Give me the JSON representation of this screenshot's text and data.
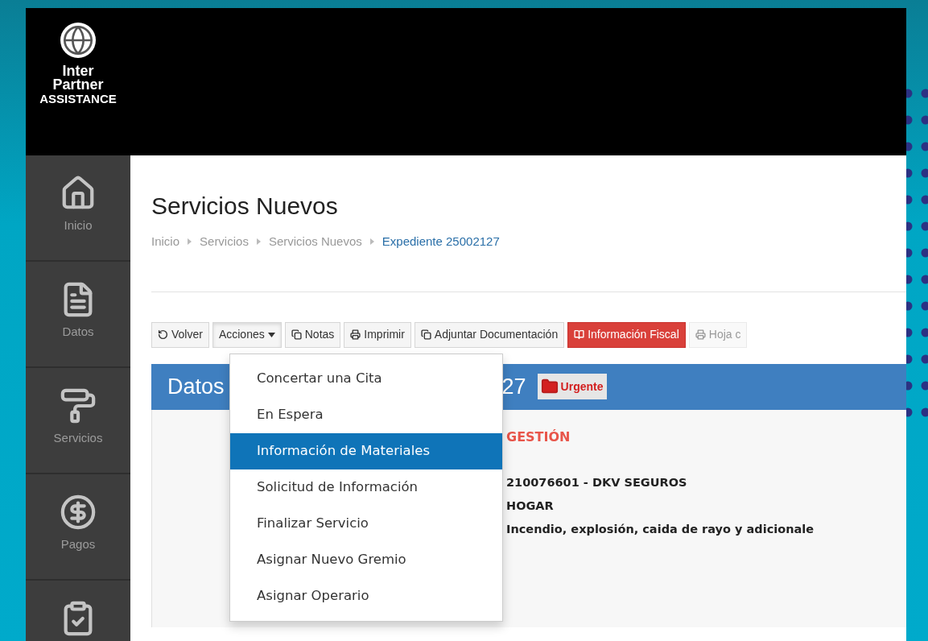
{
  "logo": {
    "lines": [
      "Inter",
      "Partner",
      "ASSISTANCE"
    ]
  },
  "sidebar": {
    "items": [
      {
        "kind": "home",
        "label": "Inicio"
      },
      {
        "kind": "document",
        "label": "Datos"
      },
      {
        "kind": "roller",
        "label": "Servicios"
      },
      {
        "kind": "dollar",
        "label": "Pagos"
      },
      {
        "kind": "clipboard"
      }
    ]
  },
  "page": {
    "title": "Servicios Nuevos"
  },
  "breadcrumb": [
    {
      "label": "Inicio",
      "current": false
    },
    {
      "label": "Servicios",
      "current": false
    },
    {
      "label": "Servicios Nuevos",
      "current": false
    },
    {
      "label": "Expediente 25002127",
      "current": true
    }
  ],
  "toolbar": [
    {
      "label": "Volver",
      "kind": "back",
      "pressed": false,
      "disabled": false
    },
    {
      "label": "Acciones",
      "kind": "dropdown",
      "pressed": true,
      "disabled": false
    },
    {
      "label": "Notas",
      "kind": "notes",
      "pressed": false,
      "disabled": false
    },
    {
      "label": "Imprimir",
      "kind": "print",
      "pressed": false,
      "disabled": false
    },
    {
      "label": "Adjuntar Documentación",
      "kind": "attach",
      "pressed": false,
      "disabled": false
    },
    {
      "label": "Información Fiscal",
      "kind": "fiscal",
      "pressed": false,
      "disabled": false
    },
    {
      "label": "Hoja c",
      "kind": "print",
      "pressed": false,
      "disabled": true
    }
  ],
  "dropdown": {
    "items": [
      {
        "label": "Concertar una Cita",
        "selected": false
      },
      {
        "label": "En Espera",
        "selected": false
      },
      {
        "label": "Información de Materiales",
        "selected": true
      },
      {
        "label": "Solicitud de Información",
        "selected": false
      },
      {
        "label": "Finalizar Servicio",
        "selected": false
      },
      {
        "label": "Asignar Nuevo Gremio",
        "selected": false
      },
      {
        "label": "Asignar Operario",
        "selected": false
      }
    ]
  },
  "panel": {
    "title_start": "Datos",
    "title_end": "27",
    "badge": "Urgente",
    "section": "GESTIÓN",
    "lines": [
      "210076601 - DKV SEGUROS",
      "HOGAR",
      "Incendio, explosión, caida de rayo y adicionale"
    ]
  }
}
